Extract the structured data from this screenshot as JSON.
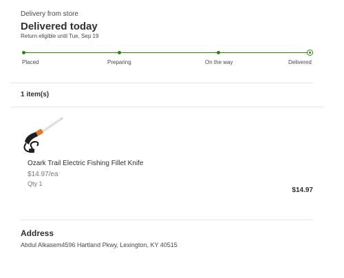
{
  "header": {
    "delivery_source": "Delivery from store",
    "status": "Delivered today",
    "return_note": "Return eligible until Tue, Sep 19"
  },
  "tracker": {
    "steps": [
      "Placed",
      "Preparing",
      "On the way",
      "Delivered"
    ],
    "current_step": "Delivered",
    "color": "#2a8703"
  },
  "items": {
    "count_label": "1 item(s)",
    "list": [
      {
        "name": "Ozark Trail Electric Fishing Fillet Knife",
        "price": "$14.97/ea",
        "qty": "Qty 1",
        "total": "$14.97",
        "image_icon": "fillet-knife-image"
      }
    ]
  },
  "address": {
    "heading": "Address",
    "text": "Abdul Alkasem4596 Hartland Pkwy, Lexington, KY 40515"
  }
}
